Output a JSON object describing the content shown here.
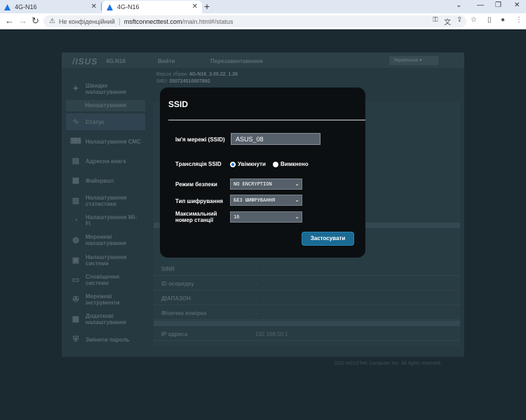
{
  "browser": {
    "tabs": [
      {
        "title": "4G-N16",
        "active": false
      },
      {
        "title": "4G-N16",
        "active": true
      }
    ],
    "new_tab": "+",
    "address": {
      "security_label": "Не конфіденційний",
      "host": "msftconnecttest.com",
      "path": "/main.html#/status"
    }
  },
  "router": {
    "logo": "/ISUS",
    "model": "4G-N16",
    "header_buttons": [
      "Вийти",
      "Перезавантаження"
    ],
    "language": "Українська",
    "firmware_label": "Версія збірки:",
    "firmware_value": "4G-N16_3.00.22_1.26",
    "imei_label": "IMEI:",
    "imei_value": "350724510007892",
    "quick_setup": "Швидке налаштування",
    "settings_header": "Налаштування",
    "sidebar": [
      "Статус",
      "Налаштування СМС",
      "Адресна книга",
      "Файервол",
      "Налаштування статистики",
      "Налаштування Wi-Fi",
      "Мережеві налаштування",
      "Налаштування системи",
      "Сповіщення системи",
      "Мережеві інструменти",
      "Додаткові налаштування",
      "Змінити пароль"
    ],
    "status_rows": [
      {
        "key": "SINR",
        "value": "-"
      },
      {
        "key": "ID осередку",
        "value": "-"
      },
      {
        "key": "ДІАПАЗОН",
        "value": "-"
      },
      {
        "key": "Фізична комірка",
        "value": "-"
      },
      {
        "key": "IP адреса",
        "value": "192.168.50.1"
      }
    ],
    "footer": "2022 ASUSTeK Computer Inc. All rights reserved."
  },
  "modal": {
    "title": "SSID",
    "ssid_label": "Ім'я мережі (SSID)",
    "ssid_value": "ASUS_08",
    "broadcast_label": "Трансляція SSID",
    "broadcast_on": "Увімкнути",
    "broadcast_off": "Вимкнено",
    "broadcast_selected": "on",
    "security_label": "Режим безпеки",
    "security_value": "NO ENCRYPTION",
    "encryption_label": "Тип шифрування",
    "encryption_value": "БЕЗ ШИФРУВАННЯ",
    "max_stations_label": "Максимальний номер станції",
    "max_stations_value": "16",
    "apply_label": "Застосувати"
  },
  "colors": {
    "modal_bg": "#0c0f11",
    "apply_button": "#1a6a94",
    "page_bg": "#1b2930"
  }
}
